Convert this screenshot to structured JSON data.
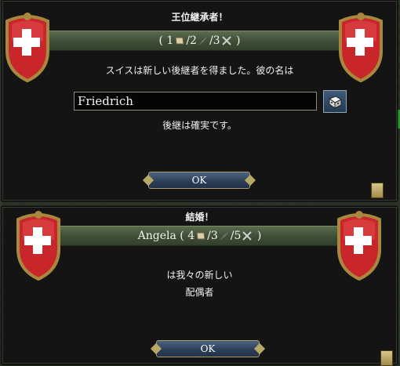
{
  "dialog1": {
    "title": "王位継承者！",
    "stats": {
      "open": "(",
      "adm": "1",
      "sep1": "/",
      "dip": "2",
      "sep2": "/",
      "mil": "3",
      "close": ")"
    },
    "message": "スイスは新しい後継者を得ました。彼の名は",
    "name_value": "Friedrich",
    "footer": "後継は確実です。",
    "ok_label": "OK"
  },
  "dialog2": {
    "title": "結婚！",
    "stats": {
      "name": "Angela",
      "open": "(",
      "adm": "4",
      "sep1": "/",
      "dip": "3",
      "sep2": "/",
      "mil": "5",
      "close": ")"
    },
    "message_line1": "は我々の新しい",
    "message_line2": "配偶者",
    "ok_label": "OK"
  },
  "colors": {
    "shield_red": "#c8262a",
    "cross": "#ffffff",
    "banner": "#4a5a40",
    "button": "#2b3d55"
  },
  "icons": [
    "swiss-shield-icon",
    "scroll-adm-icon",
    "quill-dip-icon",
    "swords-mil-icon",
    "dice-icon",
    "ledger-icon"
  ]
}
